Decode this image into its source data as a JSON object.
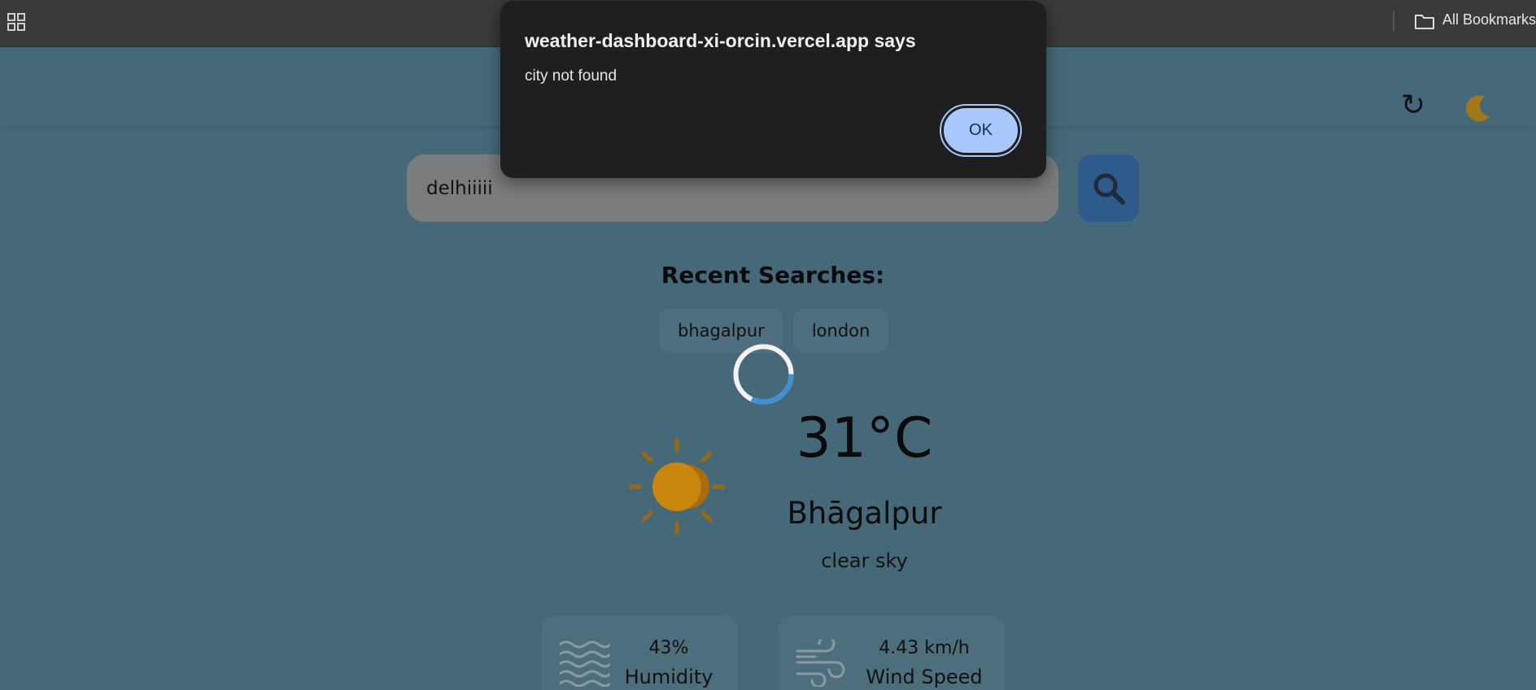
{
  "browser": {
    "bookmarks_label": "All Bookmarks",
    "icons": [
      "apps-grid-icon",
      "folder-icon"
    ]
  },
  "header": {
    "icons": [
      "refresh-icon",
      "moon-icon"
    ],
    "refresh_glyph": "↻"
  },
  "search": {
    "value": "delhiiiii",
    "button_icon": "search-icon"
  },
  "recent": {
    "title": "Recent Searches:",
    "items": [
      "bhagalpur",
      "london"
    ]
  },
  "weather": {
    "temperature": "31°C",
    "city": "Bhāgalpur",
    "description": "clear sky",
    "icon": "sun-icon",
    "loading": true
  },
  "stats": {
    "humidity": {
      "value": "43%",
      "label": "Humidity",
      "icon": "waves-icon"
    },
    "wind": {
      "value": "4.43 km/h",
      "label": "Wind Speed",
      "icon": "wind-icon"
    }
  },
  "alert": {
    "title": "weather-dashboard-xi-orcin.vercel.app says",
    "message": "city not found",
    "ok_label": "OK"
  },
  "colors": {
    "page_bg": "#46697a",
    "search_button": "#2f5a8c",
    "sun": "#c8860e",
    "dialog_bg": "#1f1f1f",
    "ok_button": "#a8c7fa"
  }
}
